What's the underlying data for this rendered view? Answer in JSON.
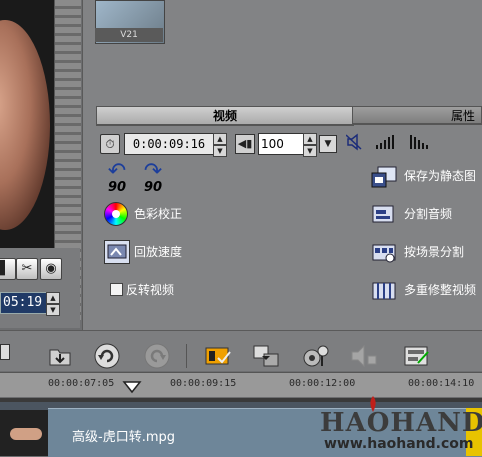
{
  "thumbnail": {
    "label": "V21"
  },
  "preview": {
    "timecode": "05:19"
  },
  "tabs": [
    {
      "label": "视频"
    },
    {
      "label": "属性"
    }
  ],
  "video": {
    "timecode": "0:00:09:16",
    "volume": "100",
    "rotate_left_label": "90",
    "rotate_right_label": "90"
  },
  "options_left": [
    {
      "label": "色彩校正",
      "icon": "color-wheel-icon"
    },
    {
      "label": "回放速度",
      "icon": "playback-speed-icon"
    },
    {
      "label": "反转视频",
      "icon": "checkbox"
    }
  ],
  "options_right": [
    {
      "label": "保存为静态图",
      "icon": "save-still-icon"
    },
    {
      "label": "分割音频",
      "icon": "split-audio-icon"
    },
    {
      "label": "按场景分割",
      "icon": "split-by-scene-icon"
    },
    {
      "label": "多重修整视频",
      "icon": "multi-trim-icon"
    }
  ],
  "ruler": {
    "ticks": [
      "00:00:07:05",
      "00:00:09:15",
      "00:00:12:00",
      "00:00:14:10"
    ]
  },
  "clip": {
    "name": "高级-虎口转.mpg"
  },
  "watermark": {
    "logo": "HAOHAND",
    "url": "www.haohand.com"
  },
  "colors": {
    "panel": "#828385",
    "tab_active": "#bdbdbd",
    "timecode_bg": "#203a66",
    "clip": "#6e8699"
  }
}
